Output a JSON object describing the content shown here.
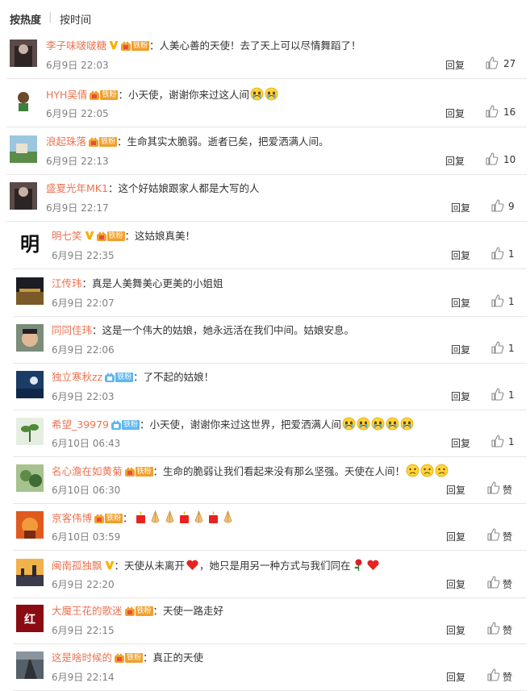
{
  "sort": {
    "hot": "按热度",
    "separator": "|",
    "time": "按时间"
  },
  "reply_label": "回复",
  "colors": {
    "username": "#eb7350",
    "fan_badge": "#f0a02c",
    "fan_badge_blue": "#5eb7ed",
    "verified": "#f7b000"
  },
  "comments": [
    {
      "user": "李子味啵啵糖",
      "text": "：人美心善的天使！去了天上可以尽情舞蹈了！",
      "time": "6月9日 22:03",
      "likes": "27",
      "verified": true,
      "fan": "铁粉",
      "avatar": "dark"
    },
    {
      "user": "HYH吴倩",
      "text": "：小天使，谢谢你来过这人间",
      "time": "6月9日 22:05",
      "likes": "16",
      "verified": false,
      "fan": "铁粉",
      "avatar": "figure"
    },
    {
      "user": "浪起珠落",
      "text": "：生命其实太脆弱。逝者已矣，把爱洒满人间。",
      "time": "6月9日 22:13",
      "likes": "10",
      "verified": false,
      "fan": "铁粉",
      "avatar": "landscape"
    },
    {
      "user": "盛夏光年MK1",
      "text": "：这个好姑娘跟家人都是大写的人",
      "time": "6月9日 22:17",
      "likes": "9",
      "verified": false,
      "fan": "",
      "avatar": "dark"
    },
    {
      "user": "明七笑",
      "text": "：这姑娘真美！",
      "time": "6月9日 22:35",
      "likes": "1",
      "verified": true,
      "fan": "铁粉",
      "avatar": "char",
      "avatar_char": "明"
    },
    {
      "user": "江传玮",
      "text": "：真是人美舞美心更美的小姐姐",
      "time": "6月9日 22:07",
      "likes": "1",
      "verified": false,
      "fan": "",
      "avatar": "night"
    },
    {
      "user": "同同佳玮",
      "text": "：这是一个伟大的姑娘，她永远活在我们中间。姑娘安息。",
      "time": "6月9日 22:06",
      "likes": "1",
      "verified": false,
      "fan": "",
      "avatar": "face"
    },
    {
      "user": "独立寒秋zz",
      "text": "：了不起的姑娘！",
      "time": "6月9日 22:03",
      "likes": "1",
      "verified": false,
      "fan": "铁粉",
      "fan_blue": true,
      "avatar": "blue"
    },
    {
      "user": "希望_39979",
      "text": "：小天使，谢谢你来过这世界，把爱洒满人间",
      "time": "6月10日 06:43",
      "likes": "1",
      "verified": false,
      "fan": "铁粉",
      "fan_blue": true,
      "avatar": "plant"
    },
    {
      "user": "名心澹在如黄菊",
      "text": "：生命的脆弱让我们看起来没有那么坚强。天使在人间！",
      "time": "6月10日 06:30",
      "likes": "赞",
      "verified": false,
      "fan": "铁粉",
      "avatar": "green"
    },
    {
      "user": "京客伟博",
      "text": "：",
      "time": "6月10日 03:59",
      "likes": "赞",
      "verified": false,
      "fan": "铁粉",
      "avatar": "orange"
    },
    {
      "user": "闽南孤独飘",
      "text": "：天使从未离开",
      "text2": "，她只是用另一种方式与我们同在",
      "time": "6月9日 22:20",
      "likes": "赞",
      "verified": true,
      "fan": "",
      "avatar": "sunset"
    },
    {
      "user": "大魔王花的歌迷",
      "text": "：天使一路走好",
      "time": "6月9日 22:15",
      "likes": "赞",
      "verified": false,
      "fan": "铁粉",
      "avatar": "red"
    },
    {
      "user": "这是啥时候的",
      "text": "：真正的天使",
      "time": "6月9日 22:14",
      "likes": "赞",
      "verified": false,
      "fan": "铁粉",
      "avatar": "road"
    }
  ]
}
